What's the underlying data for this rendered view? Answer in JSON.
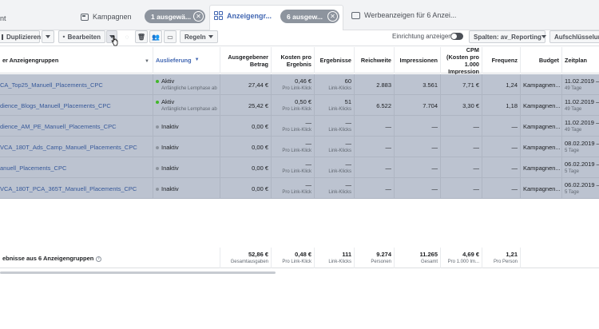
{
  "tabs": {
    "partial_label": "nt",
    "campaigns": "Kampagnen",
    "campaigns_selected": "1 ausgewä...",
    "adsets": "Anzeigengr...",
    "adsets_selected": "6 ausgew...",
    "ads": "Werbeanzeigen für 6 Anzei..."
  },
  "toolbar": {
    "duplicate": "Duplizieren",
    "edit": "Bearbeiten",
    "rules": "Regeln",
    "setup_toggle": "Einrichtung anzeigen",
    "columns": "Spalten: av_Reporting",
    "breakdown": "Aufschlüsselung"
  },
  "columns": {
    "name": "er Anzeigengruppen",
    "delivery": "Auslieferung",
    "spent": "Ausgegebener Betrag",
    "cpr": "Kosten pro Ergebnis",
    "results": "Ergebnisse",
    "reach": "Reichweite",
    "impressions": "Impressionen",
    "cpm": "CPM (Kosten pro 1.000 Impression",
    "frequency": "Frequenz",
    "budget": "Budget",
    "schedule": "Zeitplan"
  },
  "rows": [
    {
      "name": "CA_Top25_Manuell_Placements_CPC",
      "status": "Aktiv",
      "status_sub": "Anfängliche Lernphase ab",
      "spent": "27,44 €",
      "cpr": "0,46 €",
      "cpr_sub": "Pro Link-Klick",
      "results": "60",
      "results_sub": "Link-Klicks",
      "reach": "2.883",
      "impressions": "3.561",
      "cpm": "7,71 €",
      "frequency": "1,24",
      "budget": "Kampagnen...",
      "schedule": "11.02.2019 –",
      "schedule_sub": "49 Tage"
    },
    {
      "name": "dience_Blogs_Manuell_Placements_CPC",
      "status": "Aktiv",
      "status_sub": "Anfängliche Lernphase ab",
      "spent": "25,42 €",
      "cpr": "0,50 €",
      "cpr_sub": "Pro Link-Klick",
      "results": "51",
      "results_sub": "Link-Klicks",
      "reach": "6.522",
      "impressions": "7.704",
      "cpm": "3,30 €",
      "frequency": "1,18",
      "budget": "Kampagnen...",
      "schedule": "11.02.2019 –",
      "schedule_sub": "49 Tage"
    },
    {
      "name": "dience_AM_PE_Manuell_Placements_CPC",
      "status": "Inaktiv",
      "status_sub": "",
      "spent": "0,00 €",
      "cpr": "—",
      "cpr_sub": "Pro Link-Klick",
      "results": "—",
      "results_sub": "Link-Klicks",
      "reach": "—",
      "impressions": "—",
      "cpm": "—",
      "frequency": "—",
      "budget": "Kampagnen...",
      "schedule": "11.02.2019 –",
      "schedule_sub": "49 Tage"
    },
    {
      "name": "VCA_180T_Ads_Camp_Manuell_Placements_CPC",
      "status": "Inaktiv",
      "status_sub": "",
      "spent": "0,00 €",
      "cpr": "—",
      "cpr_sub": "Pro Link-Klick",
      "results": "—",
      "results_sub": "Link-Klicks",
      "reach": "—",
      "impressions": "—",
      "cpm": "—",
      "frequency": "—",
      "budget": "Kampagnen...",
      "schedule": "08.02.2019 –",
      "schedule_sub": "5 Tage"
    },
    {
      "name": "anuell_Placements_CPC",
      "status": "Inaktiv",
      "status_sub": "",
      "spent": "0,00 €",
      "cpr": "—",
      "cpr_sub": "Pro Link-Klick",
      "results": "—",
      "results_sub": "Link-Klicks",
      "reach": "—",
      "impressions": "—",
      "cpm": "—",
      "frequency": "—",
      "budget": "Kampagnen...",
      "schedule": "06.02.2019 –",
      "schedule_sub": "5 Tage"
    },
    {
      "name": "VCA_180T_PCA_365T_Manuell_Placements_CPC",
      "status": "Inaktiv",
      "status_sub": "",
      "spent": "0,00 €",
      "cpr": "—",
      "cpr_sub": "Pro Link-Klick",
      "results": "—",
      "results_sub": "Link-Klicks",
      "reach": "—",
      "impressions": "—",
      "cpm": "—",
      "frequency": "—",
      "budget": "Kampagnen...",
      "schedule": "06.02.2019 –",
      "schedule_sub": "5 Tage"
    }
  ],
  "summary": {
    "label": "ebnisse aus 6 Anzeigengruppen",
    "spent": "52,86 €",
    "spent_sub": "Gesamtausgaben",
    "cpr": "0,48 €",
    "cpr_sub": "Pro Link-Klick",
    "results": "111",
    "results_sub": "Link-Klicks",
    "reach": "9.274",
    "reach_sub": "Personen",
    "impressions": "11.265",
    "impressions_sub": "Gesamt",
    "cpm": "4,69 €",
    "cpm_sub": "Pro 1.000 Im...",
    "frequency": "1,21",
    "frequency_sub": "Pro Person"
  },
  "colors": {
    "active": "#42b72a",
    "inactive": "#8d949e",
    "selected_row": "#bcc3d0",
    "link": "#365899"
  }
}
